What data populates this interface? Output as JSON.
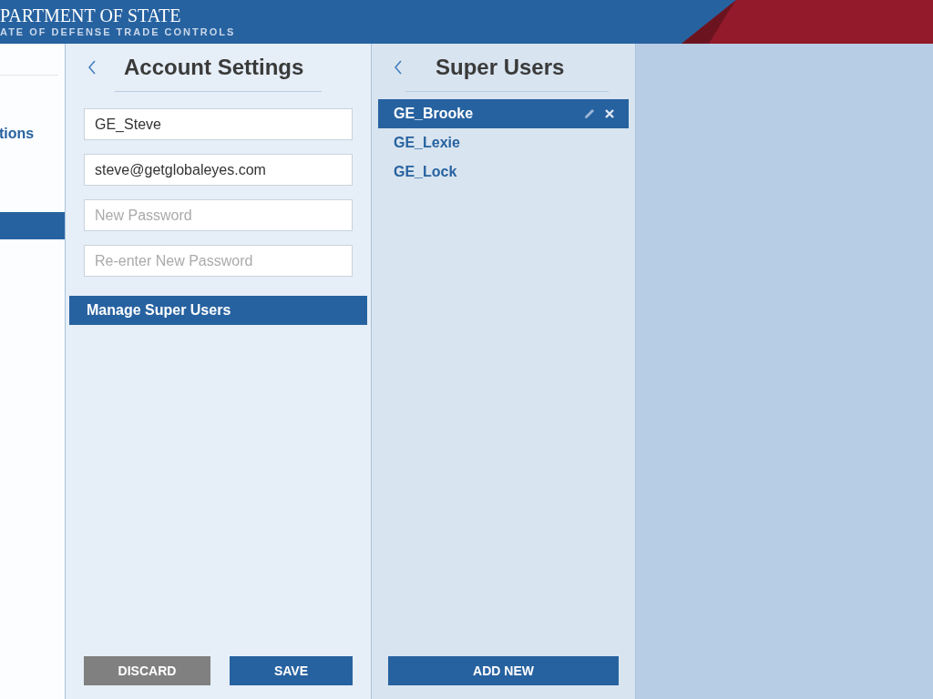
{
  "header": {
    "title": "PARTMENT OF STATE",
    "subtitle": "ATE OF DEFENSE TRADE CONTROLS"
  },
  "sidebar": {
    "items": [
      {
        "label": "tions",
        "selected": false
      },
      {
        "selected": true
      }
    ]
  },
  "account_settings": {
    "title": "Account Settings",
    "fields": [
      {
        "value": "GE_Steve"
      },
      {
        "value": "steve@getglobaleyes.com"
      },
      {
        "placeholder": "New Password"
      },
      {
        "placeholder": "Re-enter New Password"
      }
    ],
    "menu": [
      {
        "label": "Manage Super Users",
        "selected": true
      }
    ],
    "buttons": [
      {
        "label": "DISCARD",
        "kind": "secondary"
      },
      {
        "label": "SAVE",
        "kind": "primary"
      }
    ]
  },
  "super_users": {
    "title": "Super Users",
    "users": [
      {
        "name": "GE_Brooke",
        "selected": true
      },
      {
        "name": "GE_Lexie",
        "selected": false
      },
      {
        "name": "GE_Lock",
        "selected": false
      }
    ],
    "button": "ADD NEW"
  }
}
